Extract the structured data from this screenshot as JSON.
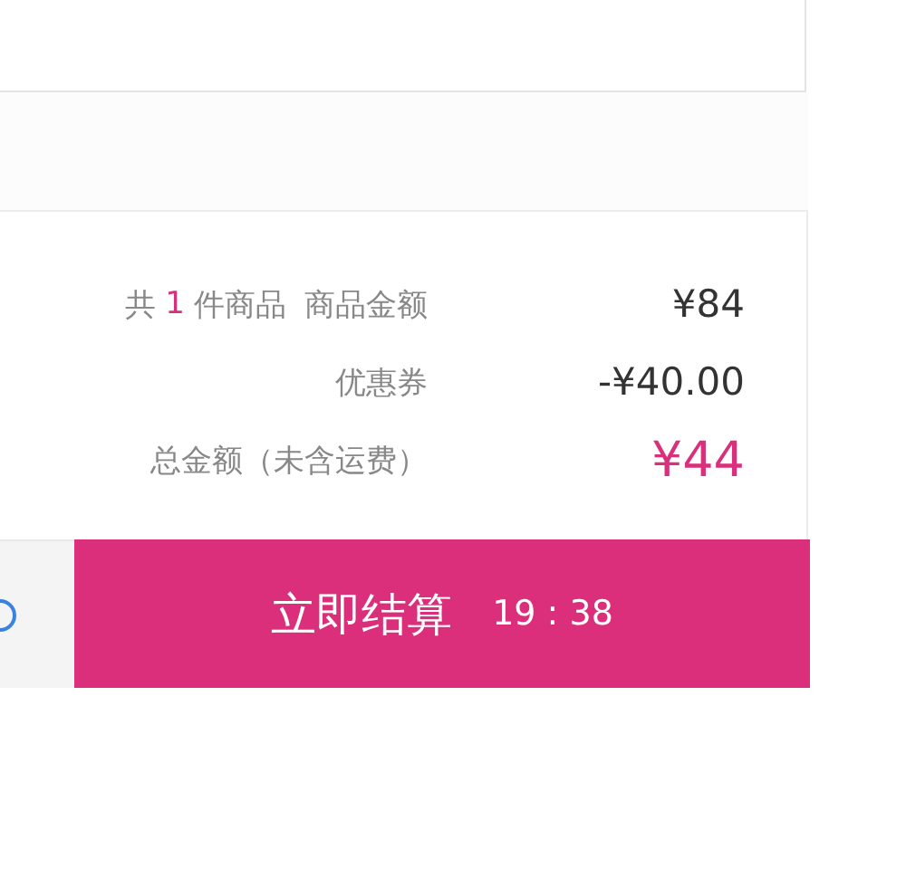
{
  "summary": {
    "item_count": {
      "prefix": "共",
      "count": "1",
      "suffix": "件商品"
    },
    "rows": [
      {
        "kind": "subtotal",
        "label": "商品金额",
        "value": "¥84"
      },
      {
        "kind": "discount",
        "label": "优惠券",
        "value": "-¥40.00"
      },
      {
        "kind": "total",
        "label": "总金额（未含运费）",
        "value": "¥44"
      }
    ]
  },
  "checkout": {
    "label": "立即结算",
    "countdown": "19 : 38"
  }
}
